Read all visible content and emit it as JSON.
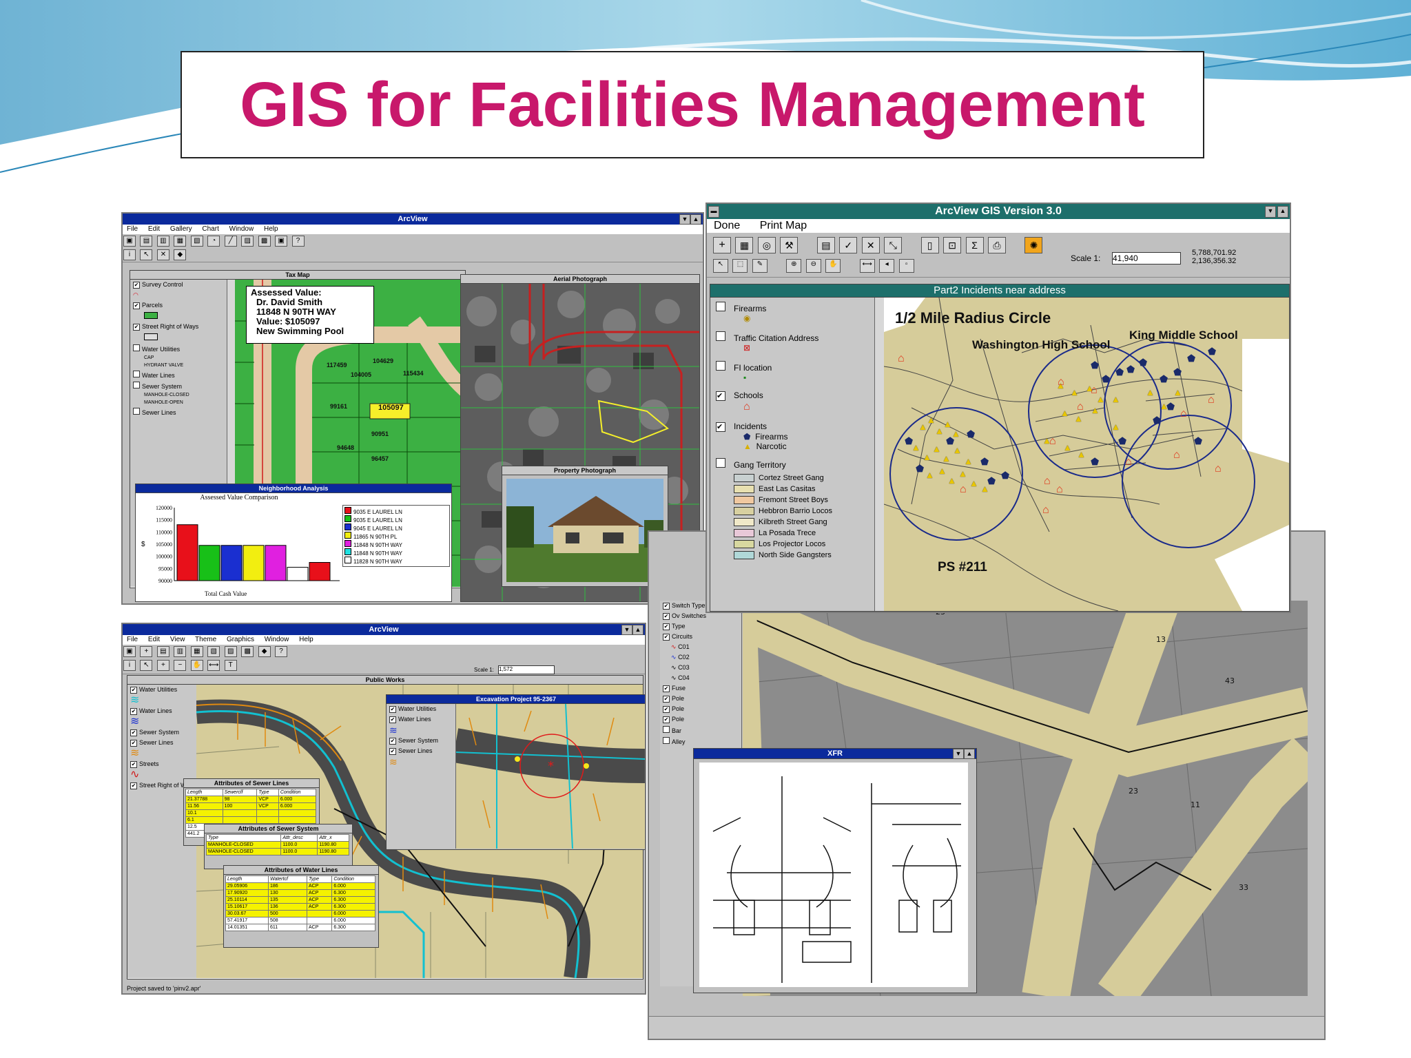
{
  "slide": {
    "title": "GIS for Facilities Management"
  },
  "colors": {
    "title": "#c8186b",
    "win_titlebar": "#0b2a9c",
    "teal_titlebar": "#1d6f6b",
    "parcel_green": "#3cb043",
    "map_tan": "#d6cc9a"
  },
  "win_tax": {
    "title": "ArcView",
    "menu": [
      "File",
      "Edit",
      "Gallery",
      "Chart",
      "Window",
      "Help"
    ],
    "tax_map_title": "Tax Map",
    "aerial_title": "Aerial Photograph",
    "legend": [
      "Survey Control",
      "Parcels",
      "Street Right of Ways",
      "Water Utilities",
      "Water Lines",
      "Sewer System",
      "Sewer Lines"
    ],
    "legend_sub": [
      "CAP",
      "HYDRANT VALVE",
      "MANHOLE-CLOSED",
      "MANHOLE-OPEN"
    ],
    "callout": [
      "Assessed Value:",
      "Dr. David Smith",
      "11848 N 90TH WAY",
      "Value:  $105097",
      "New Swimming Pool"
    ],
    "parcel_ids": [
      "117459",
      "104629",
      "104005",
      "115434",
      "99161",
      "105097",
      "90951",
      "94648",
      "96457"
    ],
    "neighborhood": {
      "title": "Neighborhood Analysis",
      "chart_title": "Assessed Value Comparison",
      "xlabel": "Total Cash Value",
      "y_symbol": "$",
      "yticks": [
        "120000",
        "115000",
        "110000",
        "105000",
        "100000",
        "95000",
        "90000"
      ],
      "legend": [
        "9035 E LAUREL LN",
        "9035 E LAUREL LN",
        "9045 E LAUREL LN",
        "11865 N 90TH PL",
        "11848 N 90TH WAY",
        "11848 N 90TH WAY",
        "11828 N 90TH WAY"
      ]
    },
    "property_photo_title": "Property Photograph"
  },
  "chart_data": {
    "type": "bar",
    "title": "Assessed Value Comparison",
    "xlabel": "Total Cash Value",
    "ylim": [
      90000,
      120000
    ],
    "categories": [
      "9035 E LAUREL LN",
      "9035 E LAUREL LN",
      "9045 E LAUREL LN",
      "11865 N 90TH PL",
      "11848 N 90TH WAY",
      "11848 N 90TH WAY",
      "11828 N 90TH WAY"
    ],
    "values": [
      113000,
      104500,
      104500,
      104500,
      104500,
      95500,
      97500
    ],
    "colors": [
      "#e8101a",
      "#18c018",
      "#1a2fd0",
      "#f2ee10",
      "#e020e0",
      "#ffffff",
      "#e8101a"
    ]
  },
  "win_incidents": {
    "title": "ArcView GIS Version 3.0",
    "menu": [
      "Done",
      "Print Map"
    ],
    "scale_label": "Scale 1:",
    "scale_value": "41,940",
    "coords": [
      "5,788,701.92",
      "2,136,356.32"
    ],
    "view_title": "Part2 Incidents near address",
    "legend": [
      {
        "label": "Firearms",
        "checked": false
      },
      {
        "label": "Traffic Citation Address",
        "checked": false
      },
      {
        "label": "FI location",
        "checked": false
      },
      {
        "label": "Schools",
        "checked": true
      },
      {
        "label": "Incidents",
        "checked": true
      }
    ],
    "incident_sub": [
      "Firearms",
      "Narcotic"
    ],
    "gang_title": "Gang Territory",
    "gangs": [
      "Cortez Street Gang",
      "East Las Casitas",
      "Fremont Street Boys",
      "Hebbron Barrio Locos",
      "Kilbreth Street Gang",
      "La Posada Trece",
      "Los Projector Locos",
      "North Side Gangsters"
    ],
    "map_labels": {
      "radius": "1/2 Mile Radius Circle",
      "washington": "Washington High School",
      "king": "King Middle School",
      "ps": "PS #211"
    }
  },
  "win_public": {
    "title": "ArcView",
    "menu": [
      "File",
      "Edit",
      "View",
      "Theme",
      "Graphics",
      "Window",
      "Help"
    ],
    "scale_label": "Scale 1:",
    "scale_value": "1,572",
    "view_title": "Public Works",
    "excavation_title": "Excavation Project 95-2367",
    "sewer_lines_table": "Attributes of Sewer Lines",
    "sewer_system_table": "Attributes of Sewer System",
    "water_lines_table": "Attributes of Water Lines",
    "sewer_cols": [
      "Length",
      "Sewerclf",
      "Type",
      "Condition"
    ],
    "sewer_rows": [
      [
        "21.37788",
        "98",
        "VCP",
        "6.000"
      ],
      [
        "11.56",
        "100",
        "VCP",
        "6.000"
      ],
      [
        "10.1",
        "",
        "",
        ""
      ],
      [
        "6.1",
        "",
        "",
        ""
      ],
      [
        "12.5",
        "",
        "",
        ""
      ],
      [
        "441.2",
        "",
        "",
        ""
      ]
    ],
    "system_cols": [
      "Type",
      "Attr_desc",
      "Attr_x"
    ],
    "system_rows": [
      [
        "MANHOLE-CLOSED",
        "1100.0",
        "1190.80"
      ],
      [
        "MANHOLE-CLOSED",
        "1100.0",
        "1190.80"
      ]
    ],
    "water_cols": [
      "Length",
      "Watertcf",
      "Type",
      "Condition"
    ],
    "water_rows": [
      [
        "29.05906",
        "186",
        "ACP",
        "6.000"
      ],
      [
        "17.90920",
        "130",
        "ACP",
        "6.300"
      ],
      [
        "25.10114",
        "135",
        "ACP",
        "6.300"
      ],
      [
        "15.10617",
        "136",
        "ACP",
        "6.300"
      ],
      [
        "30.03.67",
        "500",
        "",
        "6.000"
      ],
      [
        "57.41917",
        "508",
        "",
        "6.000"
      ],
      [
        "14.01351",
        "611",
        "ACP",
        "6.300"
      ]
    ],
    "status": "Project saved to 'pinv2.apr'",
    "legend": [
      "Water Utilities",
      "Water Lines",
      "Sewer System",
      "Sewer Lines",
      "Streets",
      "Street Right of Ways"
    ]
  },
  "win_xfr": {
    "title": "XFR",
    "side_legend": [
      "Switch Types",
      "Ov Switches",
      "Type",
      "Circuits",
      "Fuse",
      "Pole",
      "Pole",
      "Pole",
      "Bar",
      "Alley"
    ],
    "circuits": [
      "C01",
      "C02",
      "C03",
      "C04"
    ]
  }
}
